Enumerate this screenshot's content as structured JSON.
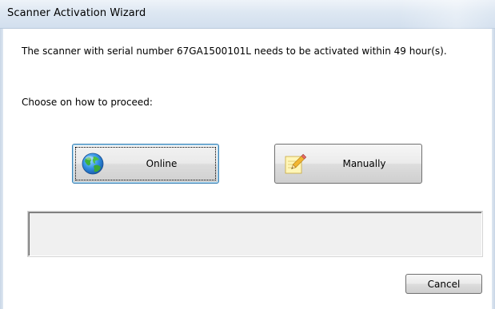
{
  "window": {
    "title": "Scanner Activation Wizard"
  },
  "content": {
    "message": "The scanner with serial number 67GA1500101L needs to be activated within 49 hour(s).",
    "prompt": "Choose on how to proceed:"
  },
  "buttons": {
    "online": {
      "label": "Online",
      "icon": "globe-icon"
    },
    "manually": {
      "label": "Manually",
      "icon": "pencil-note-icon"
    },
    "cancel": {
      "label": "Cancel"
    }
  },
  "status_panel": {
    "text": ""
  },
  "colors": {
    "titlebar": "#dde7f2",
    "focus_border": "#3c7fb1",
    "panel_background": "#f0f0f0"
  }
}
